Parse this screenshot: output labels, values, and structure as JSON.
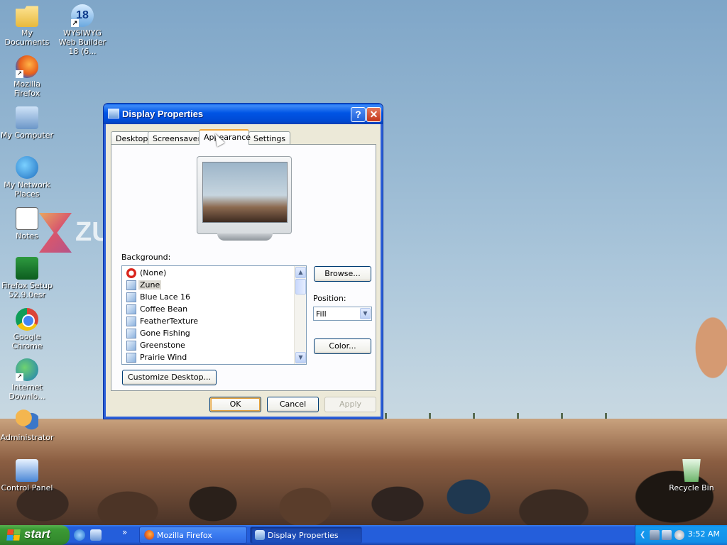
{
  "desktop": {
    "watermark_text": "ZU",
    "icons": [
      {
        "label": "My Documents",
        "icon": "my-documents-icon"
      },
      {
        "label": "WYSIWYG Web Builder 18 (6...",
        "icon": "wysiwyg-web-builder-icon",
        "badge": "18"
      },
      {
        "label": "Mozilla Firefox",
        "icon": "firefox-icon"
      },
      {
        "label": "My Computer",
        "icon": "my-computer-icon"
      },
      {
        "label": "My Network Places",
        "icon": "network-places-icon"
      },
      {
        "label": "Notes",
        "icon": "notes-icon"
      },
      {
        "label": "Firefox Setup 52.9.0esr",
        "icon": "firefox-setup-icon"
      },
      {
        "label": "Google Chrome",
        "icon": "chrome-icon"
      },
      {
        "label": "Internet Downlo...",
        "icon": "internet-download-manager-icon"
      },
      {
        "label": "Administrator",
        "icon": "administrator-icon"
      },
      {
        "label": "Control Panel",
        "icon": "control-panel-icon"
      },
      {
        "label": "Recycle Bin",
        "icon": "recycle-bin-icon"
      }
    ]
  },
  "dialog": {
    "title": "Display Properties",
    "help_glyph": "?",
    "close_glyph": "✕",
    "tabs": [
      {
        "label": "Desktop",
        "active": false
      },
      {
        "label": "Screensaver",
        "active": false
      },
      {
        "label": "Appearance",
        "active": true
      },
      {
        "label": "Settings",
        "active": false
      }
    ],
    "background_label": "Background:",
    "backgrounds": [
      {
        "label": "(None)",
        "selected": false
      },
      {
        "label": "Zune",
        "selected": true
      },
      {
        "label": "Blue Lace 16",
        "selected": false
      },
      {
        "label": "Coffee Bean",
        "selected": false
      },
      {
        "label": "FeatherTexture",
        "selected": false
      },
      {
        "label": "Gone Fishing",
        "selected": false
      },
      {
        "label": "Greenstone",
        "selected": false
      },
      {
        "label": "Prairie Wind",
        "selected": false
      }
    ],
    "scroll_up_glyph": "▲",
    "scroll_down_glyph": "▼",
    "browse_label": "Browse...",
    "position_label": "Position:",
    "position_value": "Fill",
    "combo_glyph": "▼",
    "color_label": "Color...",
    "customize_label": "Customize Desktop...",
    "ok_label": "OK",
    "cancel_label": "Cancel",
    "apply_label": "Apply"
  },
  "taskbar": {
    "start_label": "start",
    "quick_launch_overflow": "»",
    "buttons": [
      {
        "label": "Mozilla Firefox",
        "active": false,
        "icon": "firefox-icon"
      },
      {
        "label": "Display Properties",
        "active": true,
        "icon": "display-properties-icon"
      }
    ],
    "clock": "3:52 AM"
  },
  "colors": {
    "titlebar": "#0055e5",
    "taskbar": "#245edb",
    "start_button": "#3c9a35",
    "tray": "#1290e8",
    "dialog_face": "#ece9d8",
    "active_tab_accent": "#f3a73a"
  }
}
